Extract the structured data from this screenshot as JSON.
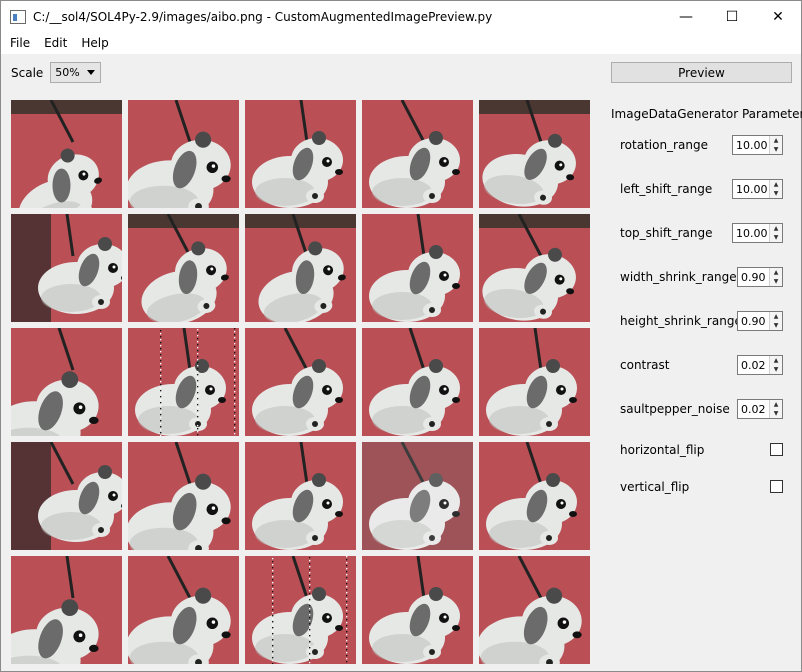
{
  "window": {
    "title": "C:/__sol4/SOL4Py-2.9/images/aibo.png - CustomAugmentedImagePreview.py",
    "controls": {
      "minimize": "—",
      "maximize": "☐",
      "close": "✕"
    }
  },
  "menu": {
    "file": "File",
    "edit": "Edit",
    "help": "Help"
  },
  "scale": {
    "label": "Scale",
    "value": "50%"
  },
  "preview_button": "Preview",
  "params": {
    "title": "ImageDataGenerator Parameters:",
    "rotation_range": {
      "label": "rotation_range",
      "value": "10.00"
    },
    "left_shift_range": {
      "label": "left_shift_range",
      "value": "10.00"
    },
    "top_shift_range": {
      "label": "top_shift_range",
      "value": "10.00"
    },
    "width_shrink_range": {
      "label": "width_shrink_range",
      "value": "0.90"
    },
    "height_shrink_range": {
      "label": "height_shrink_range",
      "value": "0.90"
    },
    "contrast": {
      "label": "contrast",
      "value": "0.02"
    },
    "saultpepper_noise": {
      "label": "saultpepper_noise",
      "value": "0.02"
    },
    "horizontal_flip": {
      "label": "horizontal_flip",
      "checked": false
    },
    "vertical_flip": {
      "label": "vertical_flip",
      "checked": false
    }
  },
  "thumbnails": [
    {
      "variant": "rotated-left"
    },
    {
      "variant": "zoom"
    },
    {
      "variant": "normal"
    },
    {
      "variant": "normal"
    },
    {
      "variant": "tilted"
    },
    {
      "variant": "body-dark"
    },
    {
      "variant": "rotated"
    },
    {
      "variant": "rotated"
    },
    {
      "variant": "normal"
    },
    {
      "variant": "tilted"
    },
    {
      "variant": "head"
    },
    {
      "variant": "noise"
    },
    {
      "variant": "normal"
    },
    {
      "variant": "normal"
    },
    {
      "variant": "normal"
    },
    {
      "variant": "body-dark"
    },
    {
      "variant": "zoom"
    },
    {
      "variant": "normal"
    },
    {
      "variant": "contrast"
    },
    {
      "variant": "normal"
    },
    {
      "variant": "head"
    },
    {
      "variant": "zoom"
    },
    {
      "variant": "noise"
    },
    {
      "variant": "normal"
    },
    {
      "variant": "zoom"
    }
  ],
  "colors": {
    "wall": "#c0555a",
    "wall_dark": "#a8434a",
    "body": "#e6e8e6",
    "body_shade": "#b8bbb8",
    "ear": "#6b6b6b",
    "dark_bg": "#2c3328"
  }
}
